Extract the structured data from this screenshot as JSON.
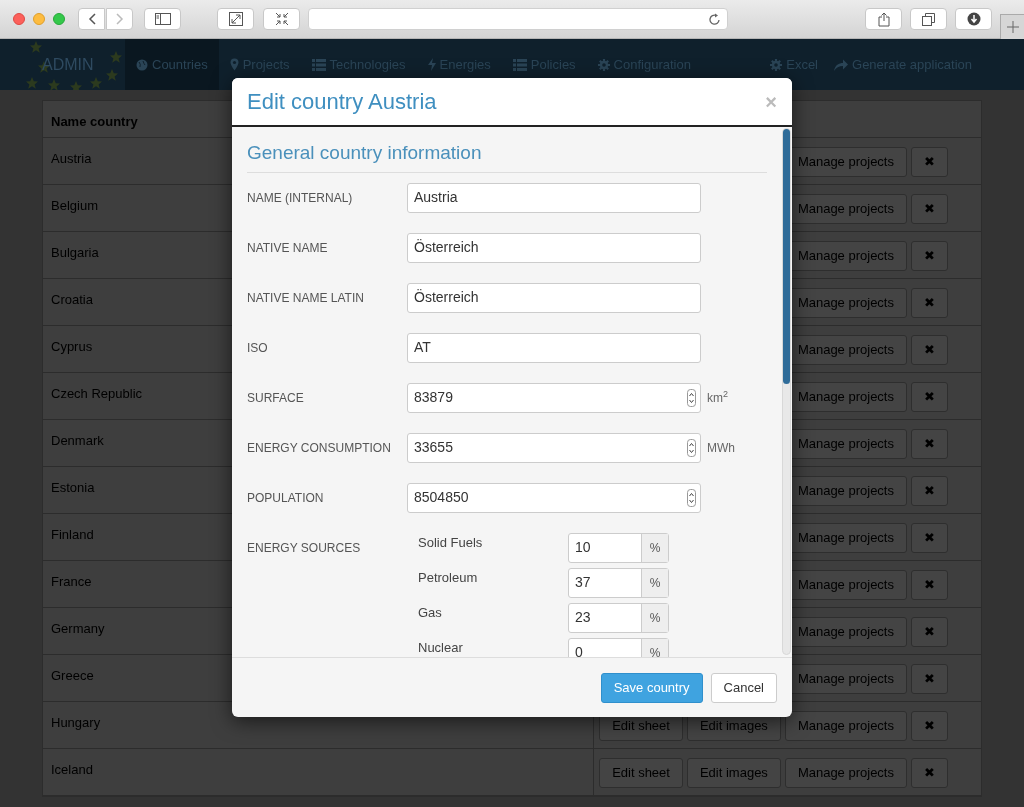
{
  "navbar": {
    "logo": "ADMIN",
    "items": [
      {
        "label": "Countries",
        "selected": true
      },
      {
        "label": "Projects",
        "selected": false
      },
      {
        "label": "Technologies",
        "selected": false
      },
      {
        "label": "Energies",
        "selected": false
      },
      {
        "label": "Policies",
        "selected": false
      },
      {
        "label": "Configuration",
        "selected": false
      }
    ],
    "right_items": [
      "Excel",
      "Generate application"
    ]
  },
  "table": {
    "columns": [
      "Name country"
    ],
    "rows": [
      {
        "name": "Austria",
        "buttons": [
          "Manage projects",
          "✖"
        ]
      },
      {
        "name": "Belgium",
        "buttons": [
          "Manage projects",
          "✖"
        ]
      },
      {
        "name": "Bulgaria",
        "buttons": [
          "Manage projects",
          "✖"
        ]
      },
      {
        "name": "Croatia",
        "buttons": [
          "Manage projects",
          "✖"
        ]
      },
      {
        "name": "Cyprus",
        "buttons": [
          "Manage projects",
          "✖"
        ]
      },
      {
        "name": "Czech Republic",
        "buttons": [
          "Manage projects",
          "✖"
        ]
      },
      {
        "name": "Denmark",
        "buttons": [
          "Manage projects",
          "✖"
        ]
      },
      {
        "name": "Estonia",
        "buttons": [
          "Manage projects",
          "✖"
        ]
      },
      {
        "name": "Finland",
        "buttons": [
          "Manage projects",
          "✖"
        ]
      },
      {
        "name": "France",
        "buttons": [
          "Manage projects",
          "✖"
        ]
      },
      {
        "name": "Germany",
        "buttons": [
          "Manage projects",
          "✖"
        ]
      },
      {
        "name": "Greece",
        "buttons": [
          "Manage projects",
          "✖"
        ]
      },
      {
        "name": "Hungary",
        "buttons": [
          "Edit sheet",
          "Edit images",
          "Manage projects",
          "✖"
        ]
      },
      {
        "name": "Iceland",
        "buttons": [
          "Edit sheet",
          "Edit images",
          "Manage projects",
          "✖"
        ]
      }
    ]
  },
  "modal": {
    "title": "Edit country Austria",
    "close": "×",
    "section_title": "General country information",
    "fields": [
      {
        "label": "NAME (INTERNAL)",
        "value": "Austria",
        "kind": "text"
      },
      {
        "label": "NATIVE NAME",
        "value": "Österreich",
        "kind": "text"
      },
      {
        "label": "NATIVE NAME LATIN",
        "value": "Österreich",
        "kind": "text"
      },
      {
        "label": "ISO",
        "value": "AT",
        "kind": "text"
      },
      {
        "label": "SURFACE",
        "value": "83879",
        "kind": "number",
        "unit": "km$^{2}$"
      },
      {
        "label": "ENERGY CONSUMPTION",
        "value": "33655",
        "kind": "number",
        "unit": "MWh"
      },
      {
        "label": "POPULATION",
        "value": "8504850",
        "kind": "number"
      }
    ],
    "energy_sources": {
      "label": "ENERGY SOURCES",
      "items": [
        {
          "name": "Solid Fuels",
          "value": "10",
          "unit": "%"
        },
        {
          "name": "Petroleum",
          "value": "37",
          "unit": "%"
        },
        {
          "name": "Gas",
          "value": "23",
          "unit": "%"
        },
        {
          "name": "Nuclear",
          "value": "0",
          "unit": "%"
        }
      ]
    },
    "buttons": [
      {
        "label": "Save country",
        "kind": "primary"
      },
      {
        "label": "Cancel",
        "kind": "default"
      }
    ]
  }
}
